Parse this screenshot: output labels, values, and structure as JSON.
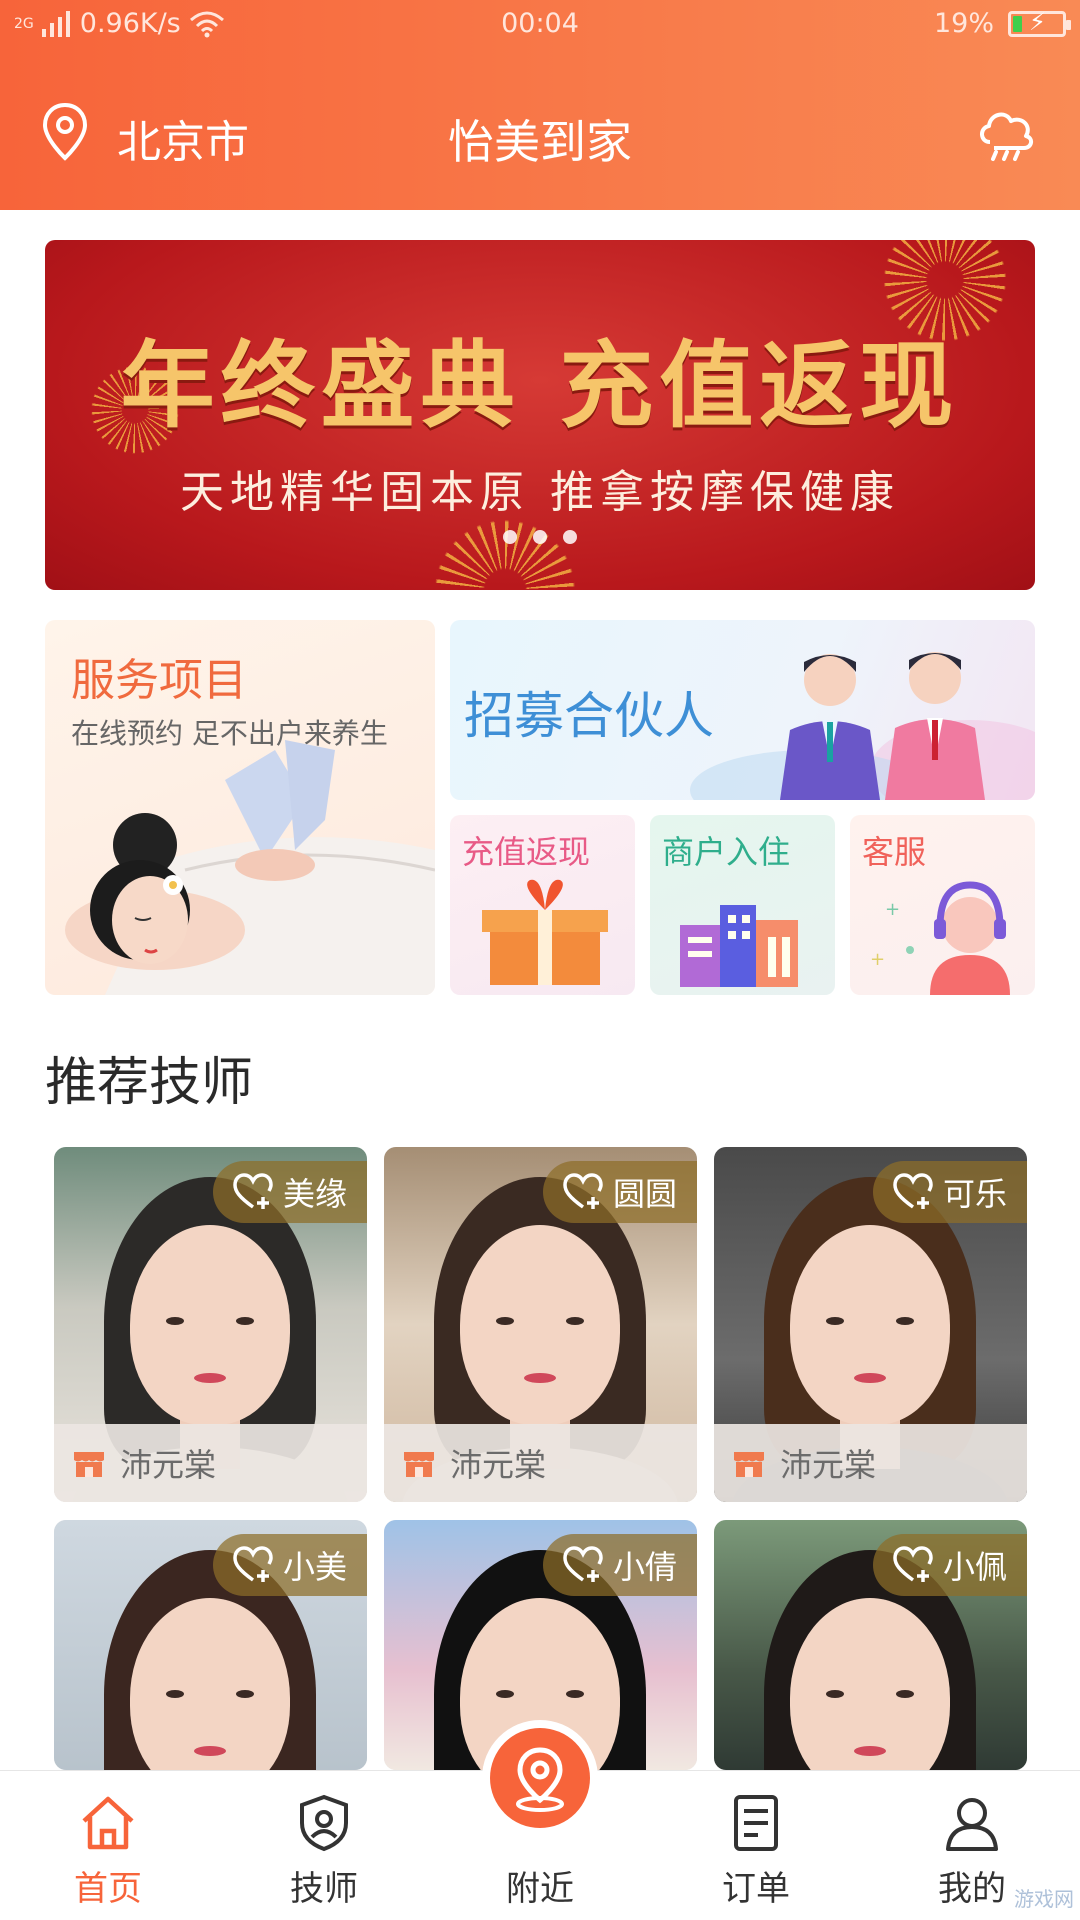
{
  "status_bar": {
    "network": "2G",
    "speed": "0.96K/s",
    "time": "00:04",
    "battery": "19%",
    "battery_level": 0.19
  },
  "header": {
    "city": "北京市",
    "title": "怡美到家"
  },
  "banner": {
    "headline": "年终盛典 充值返现",
    "subline": "天地精华固本原  推拿按摩保健康",
    "page_count": 3
  },
  "features": {
    "service": {
      "title": "服务项目",
      "subtitle": "在线预约 足不出户来养生"
    },
    "recruit": {
      "title": "招募合伙人"
    },
    "recharge": {
      "title": "充值返现"
    },
    "merchant": {
      "title": "商户入住"
    },
    "support": {
      "title": "客服"
    }
  },
  "section_title": "推荐技师",
  "technicians": [
    {
      "name": "美缘",
      "shop": "沛元棠"
    },
    {
      "name": "圆圆",
      "shop": "沛元棠"
    },
    {
      "name": "可乐",
      "shop": "沛元棠"
    },
    {
      "name": "小美",
      "shop": ""
    },
    {
      "name": "小倩",
      "shop": ""
    },
    {
      "name": "小佩",
      "shop": ""
    }
  ],
  "tabs": [
    {
      "label": "首页",
      "active": true
    },
    {
      "label": "技师",
      "active": false
    },
    {
      "label": "附近",
      "active": false
    },
    {
      "label": "订单",
      "active": false
    },
    {
      "label": "我的",
      "active": false
    }
  ],
  "watermark": "游戏网",
  "colors": {
    "accent": "#f7643a",
    "banner_red": "#c2201f",
    "banner_gold": "#f6c56a",
    "recruit_blue": "#3e8fd6"
  }
}
